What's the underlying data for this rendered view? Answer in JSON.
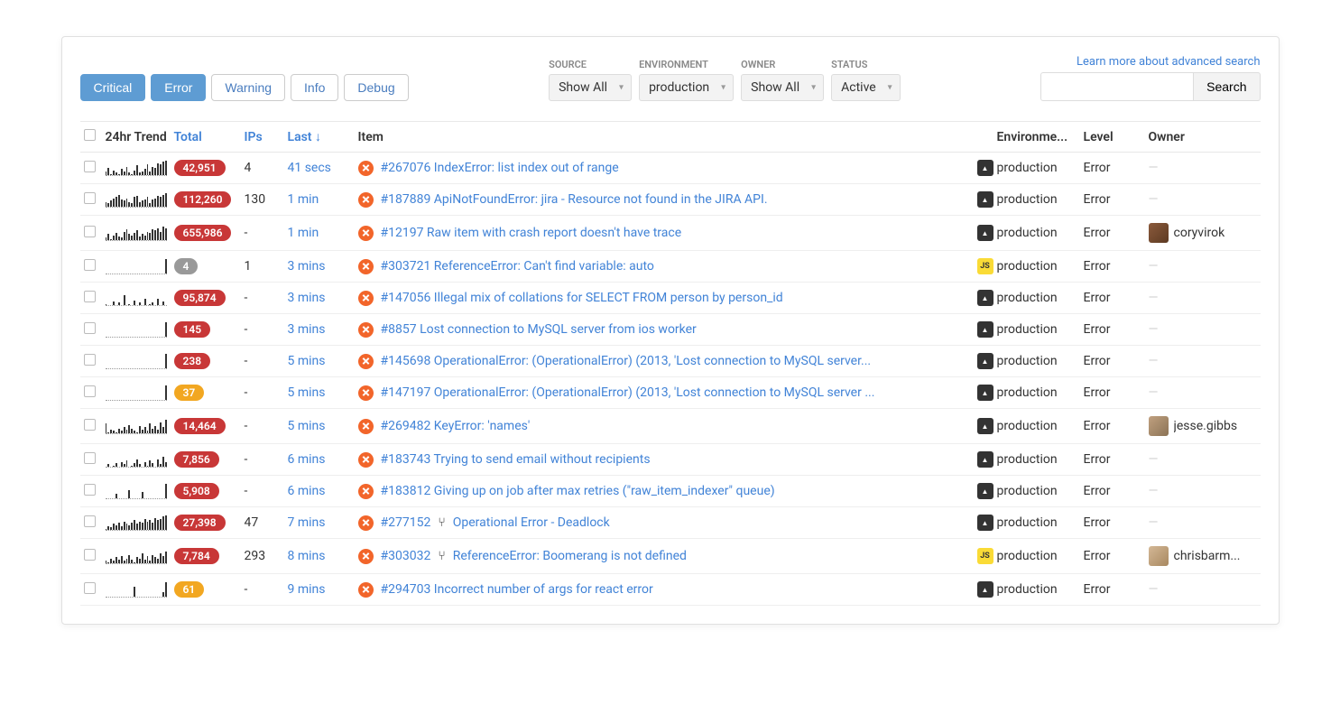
{
  "filters": {
    "critical": "Critical",
    "error": "Error",
    "warning": "Warning",
    "info": "Info",
    "debug": "Debug"
  },
  "dropdowns": {
    "source": {
      "label": "SOURCE",
      "value": "Show All"
    },
    "environment": {
      "label": "ENVIRONMENT",
      "value": "production"
    },
    "owner": {
      "label": "OWNER",
      "value": "Show All"
    },
    "status": {
      "label": "STATUS",
      "value": "Active"
    }
  },
  "search": {
    "link": "Learn more about advanced search",
    "button": "Search"
  },
  "columns": {
    "trend": "24hr Trend",
    "total": "Total",
    "ips": "IPs",
    "last": "Last ↓",
    "item": "Item",
    "env": "Environme...",
    "level": "Level",
    "owner": "Owner"
  },
  "rows": [
    {
      "spark": [
        3,
        6,
        1,
        4,
        2,
        1,
        5,
        3,
        7,
        2,
        1,
        4,
        8,
        2,
        3,
        5,
        9,
        3,
        7,
        6,
        10,
        9,
        11,
        12
      ],
      "total": "42,951",
      "badge": "red",
      "ips": "4",
      "last": "41 secs",
      "title": "#267076 IndexError: list index out of range",
      "merge": false,
      "platform": "dark",
      "env": "production",
      "level": "Error",
      "owner": null
    },
    {
      "spark": [
        4,
        3,
        5,
        7,
        8,
        10,
        6,
        5,
        7,
        4,
        3,
        8,
        9,
        4,
        5,
        6,
        8,
        3,
        6,
        7,
        9,
        8,
        10,
        11
      ],
      "total": "112,260",
      "badge": "red",
      "ips": "130",
      "last": "1 min",
      "title": "#187889 ApiNotFoundError: jira - Resource not found in the JIRA API.",
      "merge": false,
      "platform": "dark",
      "env": "production",
      "level": "Error",
      "owner": null
    },
    {
      "spark": [
        2,
        5,
        1,
        4,
        6,
        3,
        2,
        7,
        9,
        5,
        4,
        6,
        8,
        3,
        5,
        4,
        7,
        6,
        9,
        8,
        10,
        7,
        11,
        10
      ],
      "total": "655,986",
      "badge": "red",
      "ips": "-",
      "last": "1 min",
      "title": "#12197 Raw item with crash report doesn't have trace",
      "merge": false,
      "platform": "dark",
      "env": "production",
      "level": "Error",
      "owner": {
        "name": "coryvirok",
        "av": "av1"
      }
    },
    {
      "spark": [
        0,
        0,
        0,
        0,
        0,
        0,
        0,
        0,
        0,
        0,
        0,
        0,
        0,
        0,
        0,
        0,
        0,
        0,
        0,
        0,
        0,
        0,
        0,
        12
      ],
      "total": "4",
      "badge": "gray",
      "ips": "1",
      "last": "3 mins",
      "title": "#303721 ReferenceError: Can't find variable: auto",
      "merge": false,
      "platform": "js",
      "env": "production",
      "level": "Error",
      "owner": null
    },
    {
      "spark": [
        1,
        0,
        0,
        3,
        0,
        2,
        0,
        8,
        0,
        1,
        0,
        4,
        0,
        2,
        0,
        5,
        0,
        1,
        2,
        0,
        5,
        0,
        3,
        0
      ],
      "total": "95,874",
      "badge": "red",
      "ips": "-",
      "last": "3 mins",
      "title": "#147056 Illegal mix of collations for SELECT FROM person by person_id",
      "merge": false,
      "platform": "dark",
      "env": "production",
      "level": "Error",
      "owner": null
    },
    {
      "spark": [
        0,
        0,
        0,
        0,
        0,
        0,
        0,
        0,
        0,
        0,
        0,
        0,
        0,
        0,
        0,
        0,
        0,
        0,
        0,
        0,
        0,
        0,
        0,
        12
      ],
      "total": "145",
      "badge": "red",
      "ips": "-",
      "last": "3 mins",
      "title": "#8857 Lost connection to MySQL server from ios worker",
      "merge": false,
      "platform": "dark",
      "env": "production",
      "level": "Error",
      "owner": null
    },
    {
      "spark": [
        0,
        0,
        0,
        0,
        0,
        0,
        0,
        0,
        0,
        0,
        0,
        0,
        0,
        0,
        0,
        0,
        0,
        0,
        0,
        0,
        0,
        0,
        0,
        12
      ],
      "total": "238",
      "badge": "red",
      "ips": "-",
      "last": "5 mins",
      "title": "#145698 OperationalError: (OperationalError) (2013, 'Lost connection to MySQL server...",
      "merge": false,
      "platform": "dark",
      "env": "production",
      "level": "Error",
      "owner": null
    },
    {
      "spark": [
        0,
        0,
        0,
        0,
        0,
        0,
        0,
        0,
        0,
        0,
        0,
        0,
        0,
        0,
        0,
        0,
        0,
        0,
        0,
        0,
        0,
        0,
        0,
        12
      ],
      "total": "37",
      "badge": "orange",
      "ips": "-",
      "last": "5 mins",
      "title": "#147197 OperationalError: (OperationalError) (2013, 'Lost connection to MySQL server ...",
      "merge": false,
      "platform": "dark",
      "env": "production",
      "level": "Error",
      "owner": null
    },
    {
      "spark": [
        8,
        1,
        3,
        2,
        1,
        4,
        2,
        5,
        3,
        7,
        4,
        2,
        1,
        6,
        3,
        5,
        2,
        8,
        4,
        6,
        3,
        9,
        5,
        11
      ],
      "total": "14,464",
      "badge": "red",
      "ips": "-",
      "last": "5 mins",
      "title": "#269482 KeyError: 'names'",
      "merge": false,
      "platform": "dark",
      "env": "production",
      "level": "Error",
      "owner": {
        "name": "jesse.gibbs",
        "av": "av2"
      }
    },
    {
      "spark": [
        0,
        2,
        0,
        1,
        3,
        0,
        4,
        2,
        5,
        0,
        1,
        3,
        6,
        2,
        0,
        4,
        1,
        5,
        3,
        0,
        6,
        2,
        8,
        4
      ],
      "total": "7,856",
      "badge": "red",
      "ips": "-",
      "last": "6 mins",
      "title": "#183743 Trying to send email without recipients",
      "merge": false,
      "platform": "dark",
      "env": "production",
      "level": "Error",
      "owner": null
    },
    {
      "spark": [
        0,
        0,
        0,
        0,
        4,
        0,
        0,
        0,
        0,
        7,
        0,
        0,
        0,
        0,
        5,
        0,
        0,
        0,
        0,
        0,
        0,
        0,
        0,
        12
      ],
      "total": "5,908",
      "badge": "red",
      "ips": "-",
      "last": "6 mins",
      "title": "#183812 Giving up on job after max retries (\"raw_item_indexer\" queue)",
      "merge": false,
      "platform": "dark",
      "env": "production",
      "level": "Error",
      "owner": null
    },
    {
      "spark": [
        1,
        3,
        2,
        5,
        4,
        6,
        3,
        7,
        5,
        4,
        6,
        8,
        5,
        7,
        6,
        9,
        7,
        8,
        6,
        10,
        8,
        9,
        11,
        12
      ],
      "total": "27,398",
      "badge": "red",
      "ips": "47",
      "last": "7 mins",
      "title": "#277152",
      "extraTitle": "Operational Error - Deadlock",
      "merge": true,
      "platform": "dark",
      "env": "production",
      "level": "Error",
      "owner": null
    },
    {
      "spark": [
        2,
        1,
        4,
        2,
        5,
        3,
        6,
        2,
        4,
        7,
        3,
        1,
        5,
        4,
        8,
        3,
        6,
        2,
        7,
        5,
        4,
        8,
        6,
        10
      ],
      "total": "7,784",
      "badge": "red",
      "ips": "293",
      "last": "8 mins",
      "title": "#303032",
      "extraTitle": "ReferenceError: Boomerang is not defined",
      "merge": true,
      "platform": "js",
      "env": "production",
      "level": "Error",
      "owner": {
        "name": "chrisbarm...",
        "av": "av3"
      }
    },
    {
      "spark": [
        0,
        0,
        0,
        0,
        0,
        0,
        0,
        0,
        0,
        0,
        0,
        8,
        0,
        0,
        0,
        0,
        0,
        0,
        0,
        0,
        0,
        0,
        4,
        12
      ],
      "total": "61",
      "badge": "orange",
      "ips": "-",
      "last": "9 mins",
      "title": "#294703 Incorrect number of args for react error",
      "merge": false,
      "platform": "dark",
      "env": "production",
      "level": "Error",
      "owner": null
    }
  ]
}
